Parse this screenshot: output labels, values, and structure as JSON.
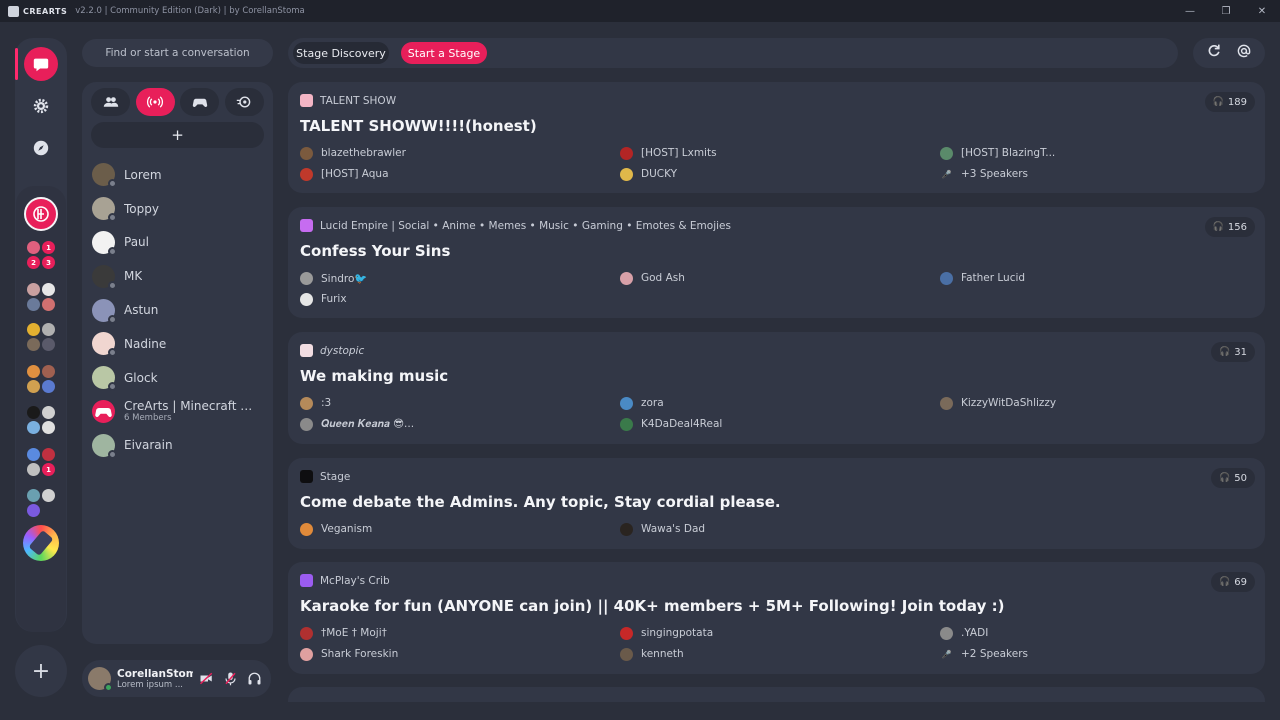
{
  "titlebar": {
    "app_name": "CREARTS",
    "subtitle": "v2.2.0 | Community Edition (Dark) | by CorellanStoma",
    "minimize_icon": "minimize-icon",
    "maximize_icon": "maximize-icon",
    "close_icon": "close-icon"
  },
  "rail": {
    "items": [
      "chat-bubble-icon",
      "gear-icon",
      "compass-icon"
    ],
    "folder_badges": [
      "1",
      "2",
      "3",
      "1"
    ],
    "add_label": "+"
  },
  "sidebar": {
    "search_placeholder": "Find or start a conversation",
    "tabs": [
      "friends-icon",
      "stage-broadcast-icon",
      "gamepad-icon",
      "speedometer-icon"
    ],
    "add_label": "+",
    "dms": [
      {
        "name": "Lorem",
        "color": "#6b5d4a"
      },
      {
        "name": "Toppy",
        "color": "#a8a294"
      },
      {
        "name": "Paul",
        "color": "#f2f2f2"
      },
      {
        "name": "MK",
        "color": "#3a3a3a"
      },
      {
        "name": "Astun",
        "color": "#8b93b8"
      },
      {
        "name": "Nadine",
        "color": "#f0d6d0"
      },
      {
        "name": "Glock",
        "color": "#b9c7a5"
      },
      {
        "name": "CreArts | Minecraft 21...",
        "sub": "6 Members",
        "color": "#e81f5a"
      },
      {
        "name": "Eivarain",
        "color": "#9fb5a0"
      }
    ]
  },
  "user": {
    "name": "CorellanStoma",
    "status": "Lorem ipsum ..."
  },
  "topbar": {
    "tab_discovery": "Stage Discovery",
    "tab_start": "Start a Stage",
    "refresh_icon": "refresh-icon",
    "mention_icon": "mention-icon"
  },
  "stages": [
    {
      "server": "TALENT SHOW",
      "server_color": "#f3b5c5",
      "count": "189",
      "title": "TALENT SHOWW!!!!(honest)",
      "speakers": [
        {
          "name": "blazethebrawler",
          "color": "#7b5a3e"
        },
        {
          "name": "[HOST] Lxmits",
          "color": "#b32525"
        },
        {
          "name": "[HOST] BlazingT...",
          "color": "#5a8a6a"
        },
        {
          "name": "[HOST] Aqua",
          "color": "#c0392b"
        },
        {
          "name": "DUCKY",
          "color": "#e0b84a"
        },
        {
          "name": "+3 Speakers",
          "mic": true
        }
      ]
    },
    {
      "server": "Lucid Empire | Social • Anime • Memes • Music • Gaming • Emotes & Emojies",
      "server_color": "#c66cf0",
      "count": "156",
      "title": "Confess Your Sins",
      "speakers": [
        {
          "name": "Sindro🐦",
          "color": "#9a9a9a"
        },
        {
          "name": "God Ash",
          "color": "#d8a0a8"
        },
        {
          "name": "Father Lucid",
          "color": "#4a6fa5"
        },
        {
          "name": "Furix",
          "color": "#e6e6e6"
        }
      ]
    },
    {
      "server": "dystopic",
      "server_italic": true,
      "server_color": "#f2dde2",
      "count": "31",
      "title": "We making music",
      "speakers": [
        {
          "name": ":3",
          "color": "#b58a5a"
        },
        {
          "name": "zora",
          "color": "#4a8ac5"
        },
        {
          "name": "KizzyWitDaShlizzy",
          "color": "#7a6a5a"
        },
        {
          "name": "𝑸𝒖𝒆𝒆𝒏 𝑲𝒆𝒂𝒏𝒂 😎...",
          "color": "#8a8a8a"
        },
        {
          "name": "K4DaDeal4Real",
          "color": "#3a7a4a"
        }
      ]
    },
    {
      "server": "Stage",
      "server_color": "#0e0e10",
      "count": "50",
      "title": "Come debate the Admins. Any topic, Stay cordial please.",
      "speakers": [
        {
          "name": "Veganism",
          "color": "#e08a3a"
        },
        {
          "name": "Wawa's Dad",
          "color": "#2a2420"
        }
      ]
    },
    {
      "server": "McPlay's Crib",
      "server_color": "#9b5cf0",
      "count": "69",
      "title": "Karaoke for fun (ANYONE can join) || 40K+ members + 5M+ Following! Join today :)",
      "speakers": [
        {
          "name": "†MoE † Moji†",
          "color": "#b03030"
        },
        {
          "name": "singingpotata",
          "color": "#c62828"
        },
        {
          "name": ".YADI",
          "color": "#8a8a8a"
        },
        {
          "name": "Shark Foreskin",
          "color": "#e0a0a0"
        },
        {
          "name": "kenneth",
          "color": "#6a5a4a"
        },
        {
          "name": "+2 Speakers",
          "mic": true
        }
      ]
    }
  ]
}
